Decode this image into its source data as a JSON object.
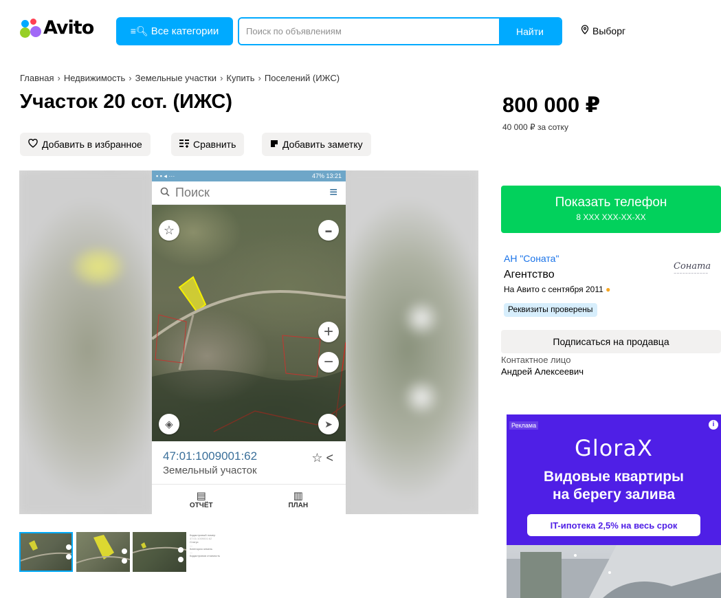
{
  "header": {
    "logo_text": "Avito",
    "categories_label": "Все категории",
    "search_placeholder": "Поиск по объявлениям",
    "search_button": "Найти",
    "location": "Выборг"
  },
  "breadcrumb": [
    "Главная",
    "Недвижимость",
    "Земельные участки",
    "Купить",
    "Поселений (ИЖС)"
  ],
  "breadcrumb_separator": "›",
  "title": "Участок 20 сот. (ИЖС)",
  "actions": {
    "favorite": "Добавить в избранное",
    "compare": "Сравнить",
    "note": "Добавить заметку"
  },
  "price": {
    "value": "800 000 ₽",
    "per_sotka": "40 000 ₽ за сотку"
  },
  "gallery": {
    "phone_status_right": "47% 13:21",
    "phone_search": "Поиск",
    "cadastral_number": "47:01:1009001:62",
    "object_type": "Земельный участок",
    "tab_report": "ОТЧЁТ",
    "tab_plan": "ПЛАН",
    "thumb_doc_lines": [
      "Кадастровый номер",
      "Статус",
      "Категория земель",
      "Кадастровая стоимость"
    ]
  },
  "seller": {
    "show_phone": "Показать телефон",
    "phone_mask": "8 XXX XXX-XX-XX",
    "name": "АН \"Соната\"",
    "type": "Агентство",
    "since": "На Авито с сентября 2011",
    "verified": "Реквизиты проверены",
    "subscribe": "Подписаться на продавца",
    "contact_label": "Контактное лицо",
    "contact_name": "Андрей Алексеевич",
    "logo_text": "Соната"
  },
  "ad": {
    "label": "Реклама",
    "brand": "GloraX",
    "headline_1": "Видовые квартиры",
    "headline_2": "на берегу залива",
    "pill": "IT-ипотека 2,5% на весь срок"
  },
  "colors": {
    "brand_blue": "#00aaff",
    "phone_green": "#02d15c",
    "ad_purple": "#4f1fe6"
  }
}
